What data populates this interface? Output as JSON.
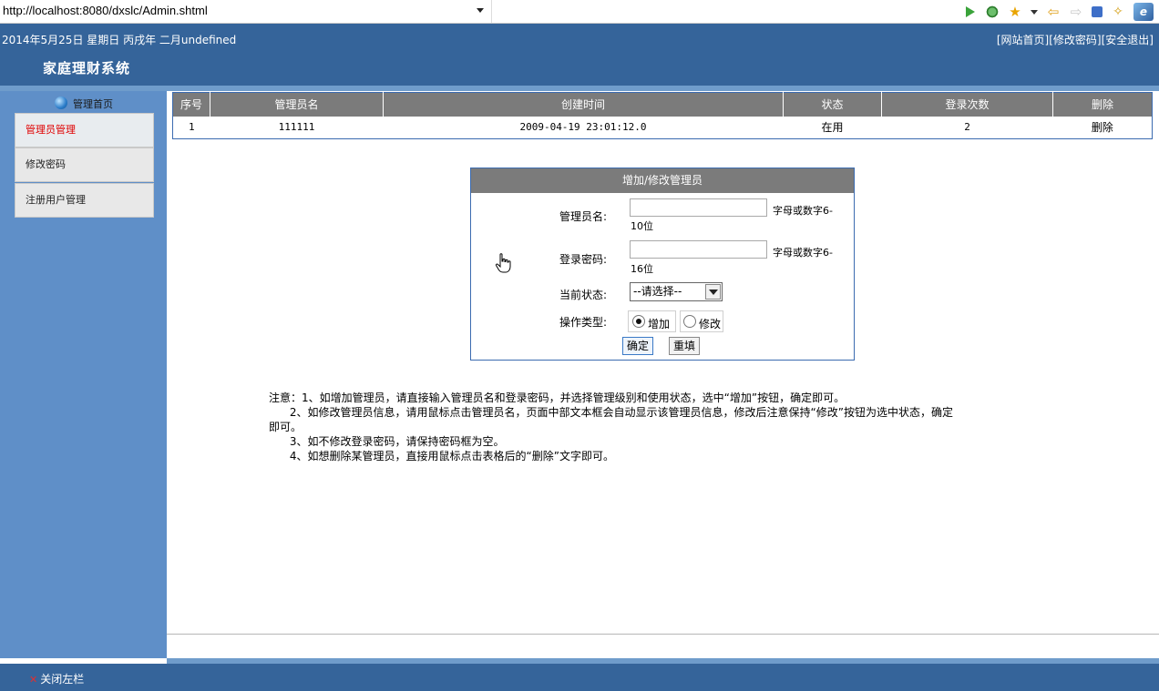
{
  "browser": {
    "url": "http://localhost:8080/dxslc/Admin.shtml",
    "tools": [
      "play-icon",
      "bug-icon",
      "star-icon",
      "dropdown-arrow-icon",
      "back-arrow-icon",
      "forward-arrow-icon",
      "stop-icon",
      "wand-icon",
      "logo-icon"
    ]
  },
  "header": {
    "date": "2014年5月25日 星期日 丙戌年 二月undefined",
    "title": "家庭理财系统",
    "links": [
      "[网站首页]",
      "[修改密码]",
      "[安全退出]"
    ]
  },
  "sidebar": {
    "home": "管理首页",
    "items": [
      "管理员管理",
      "修改密码",
      "注册用户管理"
    ]
  },
  "table": {
    "columns": [
      "序号",
      "管理员名",
      "创建时间",
      "状态",
      "登录次数",
      "删除"
    ],
    "rows": [
      {
        "no": "1",
        "name": "111111",
        "created": "2009-04-19 23:01:12.0",
        "status": "在用",
        "logins": "2",
        "delete": "删除"
      }
    ]
  },
  "form": {
    "title": "增加/修改管理员",
    "name_label": "管理员名:",
    "name_value": "",
    "name_hint_a": "字母或数字6-",
    "name_hint_b": "10位",
    "pwd_label": "登录密码:",
    "pwd_value": "",
    "pwd_hint_a": "字母或数字6-",
    "pwd_hint_b": "16位",
    "status_label": "当前状态:",
    "status_selected": "--请选择--",
    "op_label": "操作类型:",
    "op_add": "增加",
    "op_edit": "修改",
    "op_selected": "增加",
    "submit": "确定",
    "reset": "重填"
  },
  "notes": {
    "l1": "注意：1、如增加管理员，请直接输入管理员名和登录密码，并选择管理级别和使用状态，选中“增加”按钮，确定即可。",
    "l2": "      2、如修改管理员信息，请用鼠标点击管理员名，页面中部文本框会自动显示该管理员信息，修改后注意保持“修改”按钮为选中状态，确定",
    "l3": "即可。",
    "l4": "      3、如不修改登录密码，请保持密码框为空。",
    "l5": "      4、如想删除某管理员，直接用鼠标点击表格后的“删除”文字即可。"
  },
  "footer": {
    "close_left": "关闭左栏"
  },
  "colors": {
    "header_blue": "#35649a",
    "sidebar_blue": "#5f8fc8",
    "table_header_gray": "#7b7b7b",
    "active_red": "#e00000"
  }
}
